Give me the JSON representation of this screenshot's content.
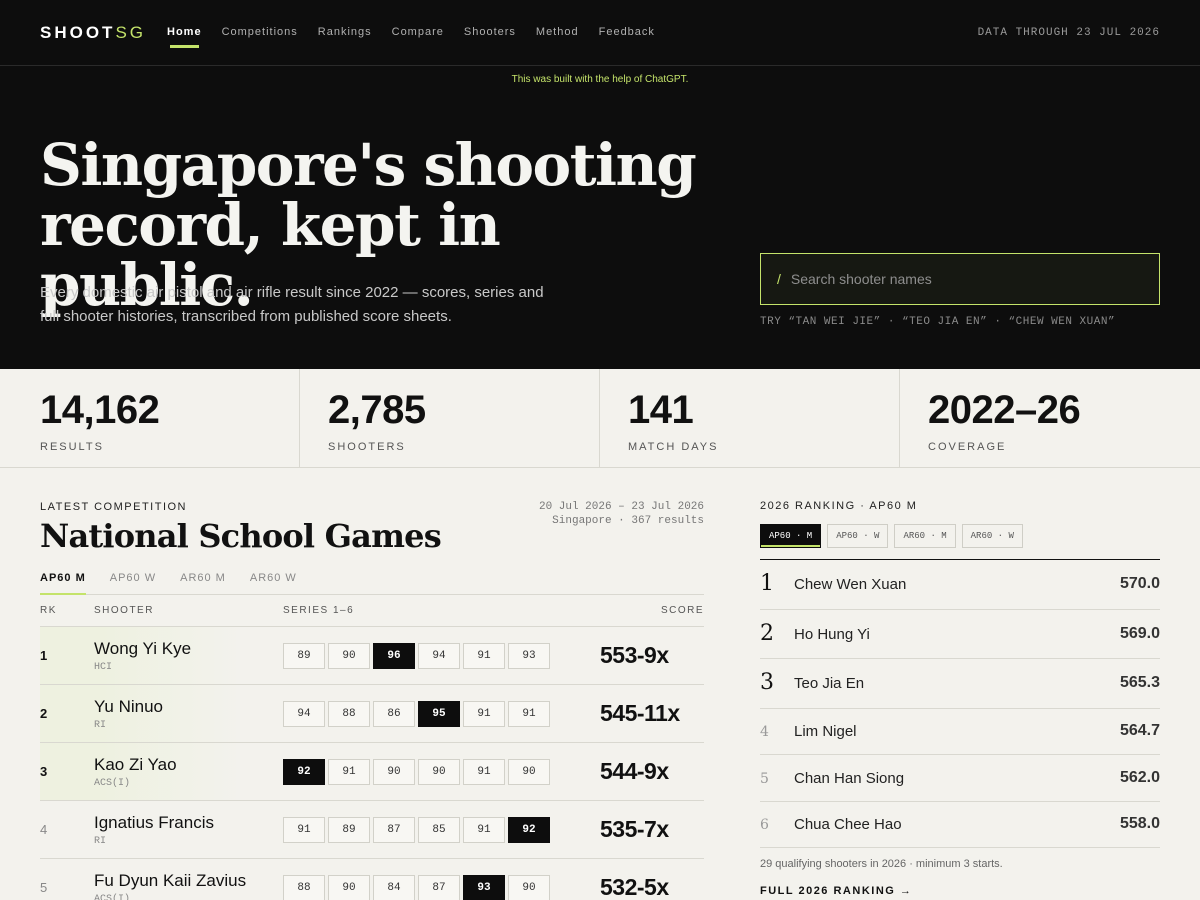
{
  "brand": {
    "name": "SHOOT",
    "suffix": "SG"
  },
  "nav": [
    {
      "label": "Home",
      "active": true
    },
    {
      "label": "Competitions"
    },
    {
      "label": "Rankings"
    },
    {
      "label": "Compare"
    },
    {
      "label": "Shooters"
    },
    {
      "label": "Method"
    },
    {
      "label": "Feedback"
    }
  ],
  "data_through": "DATA THROUGH 23 JUL 2026",
  "notice": "This was built with the help of ChatGPT.",
  "hero": {
    "title_line1": "Singapore's shooting",
    "title_line2": "record, kept in public.",
    "subtitle": "Every domestic air pistol and air rifle result since 2022 — scores, series and full shooter histories, transcribed from published score sheets."
  },
  "search": {
    "slash": "/",
    "placeholder": "Search shooter names",
    "try_text": "TRY “TAN WEI JIE” · “TEO JIA EN” · “CHEW WEN XUAN”"
  },
  "stats": [
    {
      "value": "14,162",
      "label": "RESULTS"
    },
    {
      "value": "2,785",
      "label": "SHOOTERS"
    },
    {
      "value": "141",
      "label": "MATCH DAYS"
    },
    {
      "value": "2022–26",
      "label": "COVERAGE"
    }
  ],
  "competition": {
    "eyebrow": "LATEST COMPETITION",
    "title": "National School Games",
    "dates": "20 Jul 2026 – 23 Jul 2026",
    "location_results": "Singapore · 367 results",
    "tabs": [
      {
        "label": "AP60 M",
        "active": true
      },
      {
        "label": "AP60 W"
      },
      {
        "label": "AR60 M"
      },
      {
        "label": "AR60 W"
      }
    ],
    "columns": {
      "rank": "RK",
      "shooter": "SHOOTER",
      "series": "SERIES 1–6",
      "score": "SCORE"
    },
    "rows": [
      {
        "rank": "1",
        "name": "Wong Yi Kye",
        "school": "HCI",
        "series": [
          "89",
          "90",
          "96",
          "94",
          "91",
          "93"
        ],
        "best_index": 2,
        "score": "553-9x"
      },
      {
        "rank": "2",
        "name": "Yu Ninuo",
        "school": "RI",
        "series": [
          "94",
          "88",
          "86",
          "95",
          "91",
          "91"
        ],
        "best_index": 3,
        "score": "545-11x"
      },
      {
        "rank": "3",
        "name": "Kao Zi Yao",
        "school": "ACS(I)",
        "series": [
          "92",
          "91",
          "90",
          "90",
          "91",
          "90"
        ],
        "best_index": 0,
        "score": "544-9x"
      },
      {
        "rank": "4",
        "name": "Ignatius Francis",
        "school": "RI",
        "series": [
          "91",
          "89",
          "87",
          "85",
          "91",
          "92"
        ],
        "best_index": 5,
        "score": "535-7x"
      },
      {
        "rank": "5",
        "name": "Fu Dyun Kaii Zavius",
        "school": "ACS(I)",
        "series": [
          "88",
          "90",
          "84",
          "87",
          "93",
          "90"
        ],
        "best_index": 4,
        "score": "532-5x"
      }
    ]
  },
  "ranking": {
    "eyebrow": "2026 RANKING · AP60 M",
    "tabs": [
      {
        "label": "AP60 · M",
        "active": true
      },
      {
        "label": "AP60 · W"
      },
      {
        "label": "AR60 · M"
      },
      {
        "label": "AR60 · W"
      }
    ],
    "items": [
      {
        "rank": "1",
        "name": "Chew Wen Xuan",
        "score": "570.0"
      },
      {
        "rank": "2",
        "name": "Ho Hung Yi",
        "score": "569.0"
      },
      {
        "rank": "3",
        "name": "Teo Jia En",
        "score": "565.3"
      },
      {
        "rank": "4",
        "name": "Lim Nigel",
        "score": "564.7"
      },
      {
        "rank": "5",
        "name": "Chan Han Siong",
        "score": "562.0"
      },
      {
        "rank": "6",
        "name": "Chua Chee Hao",
        "score": "558.0"
      }
    ],
    "footnote": "29 qualifying shooters in 2026 · minimum 3 starts.",
    "full_link": "FULL 2026 RANKING",
    "full_link_arrow": "→",
    "colors": {
      "accent": "#c4e36a",
      "dark": "#0d0d0d"
    }
  }
}
